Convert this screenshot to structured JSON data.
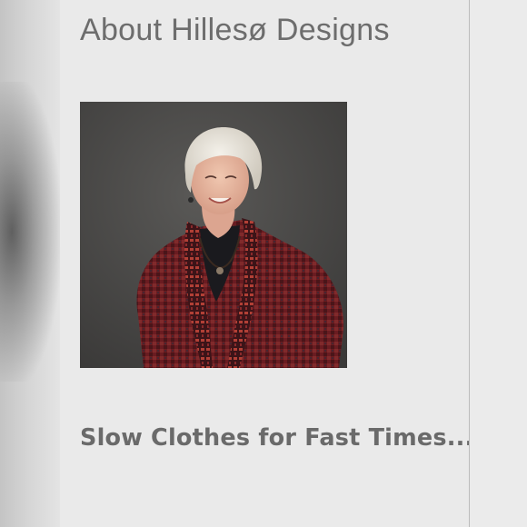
{
  "about": {
    "title": "About Hillesø Designs",
    "portrait_icon": "portrait-photo",
    "tagline": "Slow Clothes for Fast Times....."
  },
  "colors": {
    "page_background": "#eaeaea",
    "text": "#6d6d6d",
    "photo_background": "#454443",
    "jacket": "#6e1e22"
  }
}
